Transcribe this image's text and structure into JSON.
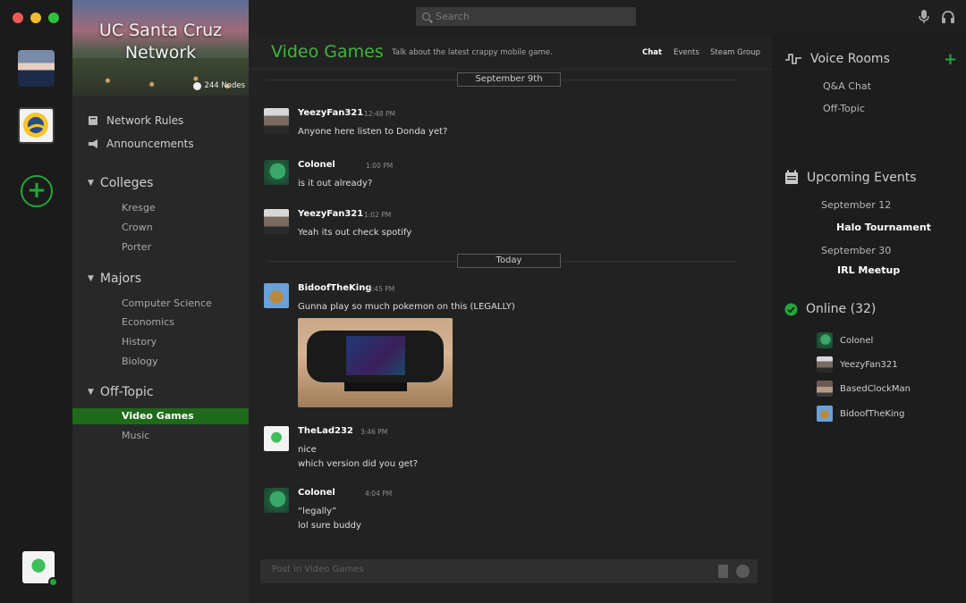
{
  "network": {
    "title": "UC Santa Cruz Network",
    "nodes": "244 Nodes"
  },
  "sidebar": {
    "links": [
      {
        "label": "Network Rules",
        "icon": "book-icon"
      },
      {
        "label": "Announcements",
        "icon": "megaphone-icon"
      }
    ],
    "categories": [
      {
        "label": "Colleges",
        "channels": [
          "Kresge",
          "Crown",
          "Porter"
        ]
      },
      {
        "label": "Majors",
        "channels": [
          "Computer Science",
          "Economics",
          "History",
          "Biology"
        ]
      },
      {
        "label": "Off-Topic",
        "channels": [
          "Video Games",
          "Music"
        ]
      }
    ],
    "active_channel": "Video Games"
  },
  "topbar": {
    "search_placeholder": "Search"
  },
  "channel": {
    "title": "Video Games",
    "topic": "Talk about the latest crappy mobile game.",
    "tabs": [
      "Chat",
      "Events",
      "Steam Group"
    ]
  },
  "dates": [
    "September 9th",
    "Today"
  ],
  "messages": [
    {
      "user": "YeezyFan321",
      "time": "12:48 PM",
      "lines": [
        "Anyone here listen to Donda yet?"
      ]
    },
    {
      "user": "Colonel",
      "time": "1:00 PM",
      "lines": [
        "is it out already?"
      ]
    },
    {
      "user": "YeezyFan321",
      "time": "1:02 PM",
      "lines": [
        "Yeah its out check spotify"
      ]
    },
    {
      "user": "BidoofTheKing",
      "time": "3:45 PM",
      "lines": [
        "Gunna play so much pokemon on this (LEGALLY)"
      ]
    },
    {
      "user": "TheLad232",
      "time": "3:46 PM",
      "lines": [
        "nice",
        "which version did you get?"
      ]
    },
    {
      "user": "Colonel",
      "time": "4:04 PM",
      "lines": [
        "“legally”",
        "lol sure buddy"
      ]
    }
  ],
  "composer": {
    "placeholder": "Post in Video Games"
  },
  "right_panel": {
    "voice": {
      "title": "Voice Rooms",
      "rooms": [
        "Q&A Chat",
        "Off-Topic"
      ]
    },
    "events": {
      "title": "Upcoming Events",
      "items": [
        {
          "date": "September 12",
          "name": "Halo Tournament"
        },
        {
          "date": "September 30",
          "name": "IRL Meetup"
        }
      ]
    },
    "online": {
      "title": "Online (32)",
      "users": [
        "Colonel",
        "YeezyFan321",
        "BasedClockMan",
        "BidoofTheKing"
      ]
    }
  },
  "colors": {
    "accent": "#3fb53a",
    "active_channel_bg": "#1e6a1a",
    "status_online": "#22a83a"
  }
}
